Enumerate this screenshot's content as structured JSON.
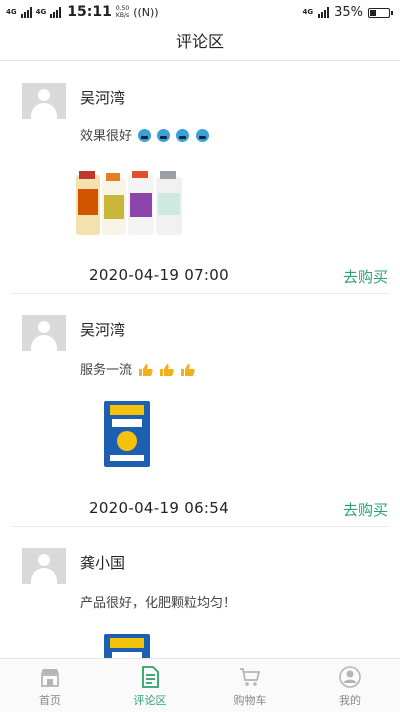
{
  "status_bar": {
    "net1": "4G",
    "net2": "4G",
    "time": "15:11",
    "speed_value": "0.50",
    "speed_unit": "KB/s",
    "nfc": "((N))",
    "net_right": "4G",
    "battery": "35%",
    "battery_level": 0.35
  },
  "header": {
    "title": "评论区"
  },
  "reviews": [
    {
      "name": "吴河湾",
      "comment": "效果很好",
      "emoji_count": 4,
      "date": "2020-04-19 07:00",
      "buy_label": "去购买"
    },
    {
      "name": "吴河湾",
      "comment": "服务一流",
      "emoji_count": 3,
      "date": "2020-04-19 06:54",
      "buy_label": "去购买"
    },
    {
      "name": "龚小国",
      "comment": "产品很好，化肥颗粒均匀！",
      "emoji_count": 0,
      "date": "",
      "buy_label": ""
    }
  ],
  "tab_bar": {
    "active_index": 1,
    "items": [
      {
        "label": "首页",
        "icon": "store-icon"
      },
      {
        "label": "评论区",
        "icon": "document-icon"
      },
      {
        "label": "购物车",
        "icon": "cart-icon"
      },
      {
        "label": "我的",
        "icon": "user-icon"
      }
    ]
  },
  "colors": {
    "accent": "#2aa36b",
    "text": "#222222",
    "avatar_placeholder": "#d9d9d9"
  }
}
